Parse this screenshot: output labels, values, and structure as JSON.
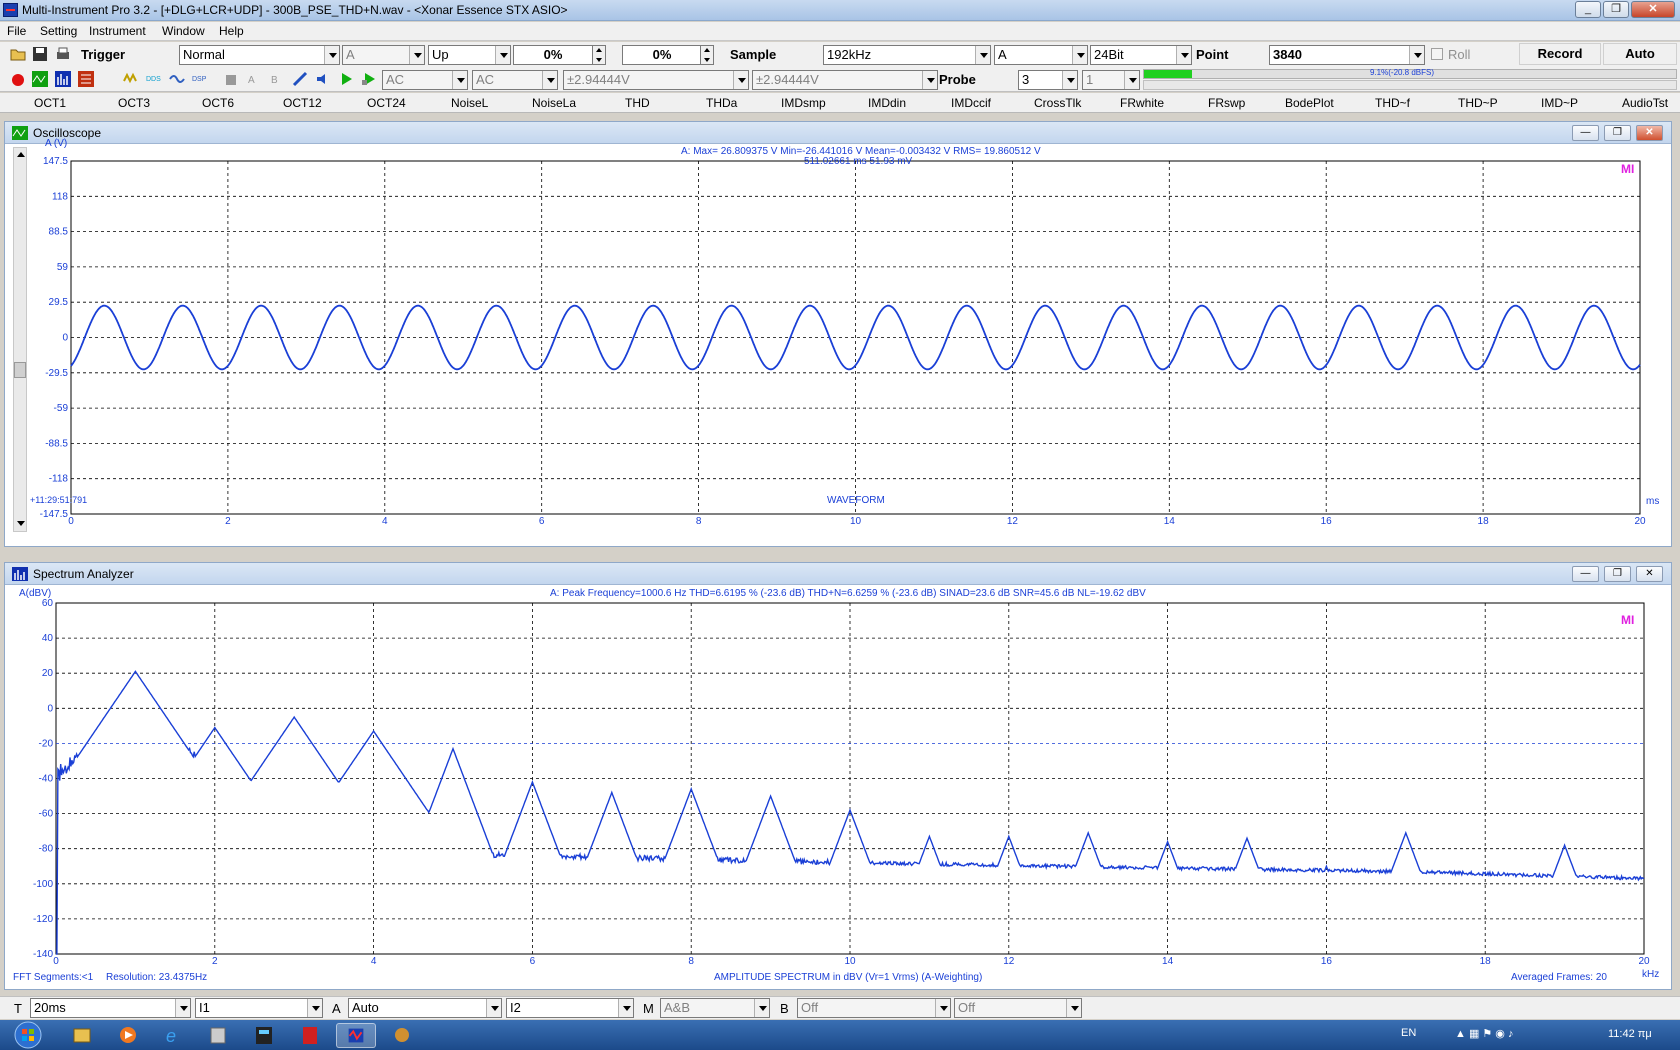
{
  "window": {
    "title": "Multi-Instrument Pro 3.2   -   [+DLG+LCR+UDP]   -   300B_PSE_THD+N.wav   -   <Xonar Essence STX ASIO>"
  },
  "menu": [
    "File",
    "Setting",
    "Instrument",
    "Window",
    "Help"
  ],
  "toolbar1": {
    "trigger_label": "Trigger",
    "trigger_mode": "Normal",
    "trigger_channel": "A",
    "trigger_edge": "Up",
    "trigger_level": "0%",
    "trigger_delay": "0%",
    "sample_label": "Sample",
    "sample_rate": "192kHz",
    "channel": "A",
    "bit_depth": "24Bit",
    "point_label": "Point",
    "points": "3840",
    "roll_label": "Roll",
    "record_label": "Record",
    "auto_label": "Auto"
  },
  "toolbar2": {
    "coupling_a": "AC",
    "coupling_b": "AC",
    "range_a": "±2.94444V",
    "range_b": "±2.94444V",
    "probe_label": "Probe",
    "probe_a": "3",
    "probe_b": "1",
    "level_text": "9.1%(-20.8 dBFS)",
    "level_fraction": 0.091
  },
  "tabs": [
    "OCT1",
    "OCT3",
    "OCT6",
    "OCT12",
    "OCT24",
    "NoiseL",
    "NoiseLa",
    "THD",
    "THDa",
    "IMDsmp",
    "IMDdin",
    "IMDccif",
    "CrossTlk",
    "FRwhite",
    "FRswp",
    "BodePlot",
    "THD~f",
    "THD~P",
    "IMD~P",
    "AudioTst"
  ],
  "oscilloscope": {
    "title": "Oscilloscope",
    "y_label": "A (V)",
    "stats": "A: Max= 26.809375 V  Min=-26.441016 V  Mean=-0.003432 V  RMS= 19.860512 V",
    "cursor": "511.02661 ms  51.93 mV",
    "timestamp": "+11:29:51:791",
    "x_title": "WAVEFORM",
    "x_unit": "ms",
    "logo": "MI",
    "y_ticks": [
      "147.5",
      "118",
      "88.5",
      "59",
      "29.5",
      "0",
      "-29.5",
      "-59",
      "-88.5",
      "-118",
      "-147.5"
    ],
    "x_ticks": [
      "0",
      "2",
      "4",
      "6",
      "8",
      "10",
      "12",
      "14",
      "16",
      "18",
      "20"
    ]
  },
  "spectrum": {
    "title": "Spectrum Analyzer",
    "y_label": "A(dBV)",
    "stats": "A: Peak Frequency=1000.6 Hz  THD=6.6195 % (-23.6 dB)  THD+N=6.6259 % (-23.6 dB)  SINAD=23.6 dB  SNR=45.6 dB  NL=-19.62 dBV",
    "fft_segments": "FFT Segments:<1",
    "resolution": "Resolution: 23.4375Hz",
    "x_title": "AMPLITUDE SPECTRUM in dBV (Vr=1 Vrms) (A-Weighting)",
    "averaged": "Averaged Frames: 20",
    "x_unit": "kHz",
    "logo": "MI",
    "y_ticks": [
      "60",
      "40",
      "20",
      "0",
      "-20",
      "-40",
      "-60",
      "-80",
      "-100",
      "-120",
      "-140"
    ],
    "x_ticks": [
      "0",
      "2",
      "4",
      "6",
      "8",
      "10",
      "12",
      "14",
      "16",
      "18",
      "20"
    ]
  },
  "chart_data": [
    {
      "type": "line",
      "title": "WAVEFORM",
      "xlabel": "ms",
      "ylabel": "A (V)",
      "xlim": [
        0,
        20
      ],
      "ylim": [
        -147.5,
        147.5
      ],
      "grid": true,
      "series": [
        {
          "name": "A",
          "waveform": "sine",
          "frequency_hz": 1000.6,
          "amplitude_v": 26.6,
          "x_range": [
            0,
            20
          ]
        }
      ],
      "color": "#1a3fd6"
    },
    {
      "type": "line",
      "title": "AMPLITUDE SPECTRUM in dBV (Vr=1 Vrms) (A-Weighting)",
      "xlabel": "kHz",
      "ylabel": "A(dBV)",
      "xlim": [
        0,
        20
      ],
      "ylim": [
        -140,
        60
      ],
      "grid": true,
      "series": [
        {
          "name": "A",
          "peaks_khz": [
            1,
            2,
            3,
            4,
            5,
            6,
            7,
            8,
            9,
            10,
            11,
            12,
            13,
            14,
            15,
            16,
            17,
            18,
            19
          ],
          "peaks_dbv": [
            21,
            -11,
            -5,
            -13,
            -23,
            -42,
            -48,
            -46,
            -50,
            -58,
            -73,
            -73,
            -71,
            -76,
            -74,
            -90,
            -71,
            -98,
            -78
          ],
          "floor_dbv": [
            [
              0,
              -80
            ],
            [
              3,
              -80
            ],
            [
              5,
              -83
            ],
            [
              8,
              -86
            ],
            [
              10,
              -88
            ],
            [
              14,
              -91
            ],
            [
              17,
              -93
            ],
            [
              20,
              -97
            ]
          ]
        }
      ],
      "color": "#1a3fd6"
    }
  ],
  "statusbar": {
    "t_label": "T",
    "t_value": "20ms",
    "i1": "I1",
    "a_label": "A",
    "a_value": "Auto",
    "i2": "I2",
    "m_label": "M",
    "m_value": "A&B",
    "b_label": "B",
    "b_value": "Off",
    "b2_value": "Off"
  },
  "taskbar": {
    "lang": "EN",
    "time": "11:42 πμ"
  }
}
